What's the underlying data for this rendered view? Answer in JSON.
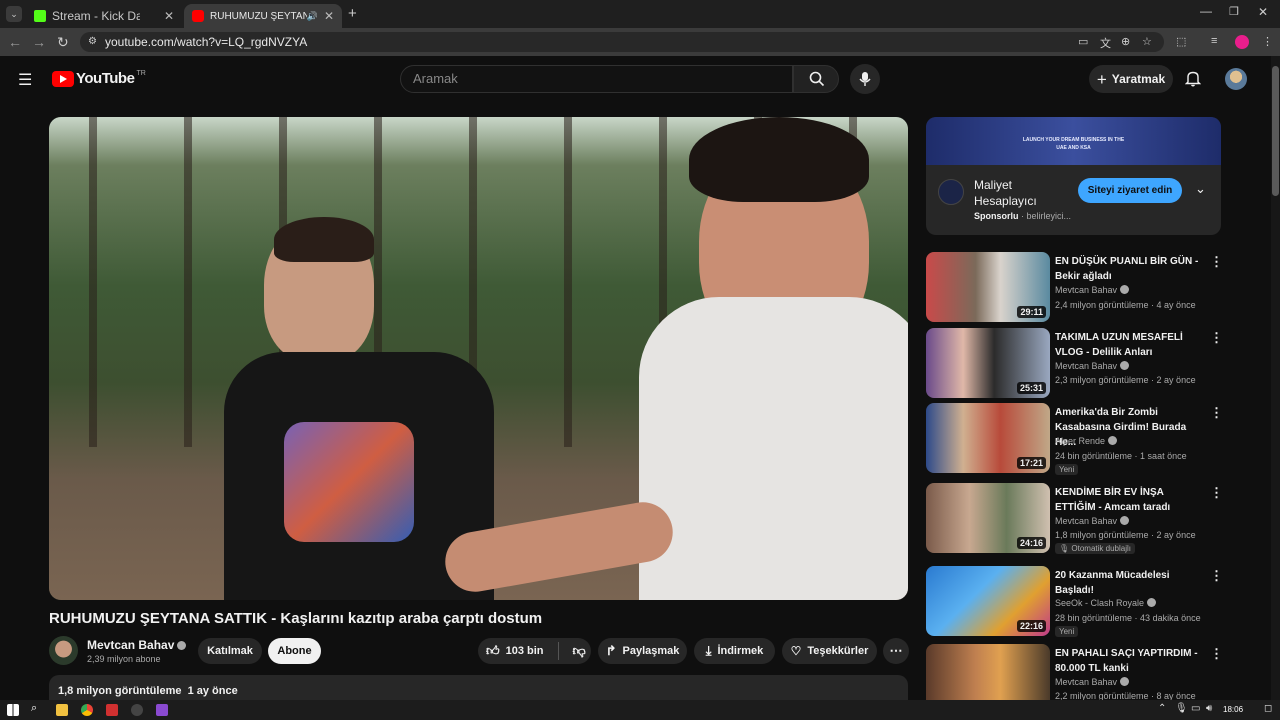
{
  "browser": {
    "tabs": [
      {
        "title": "Stream - Kick Dashboard",
        "active": false
      },
      {
        "title": "RUHUMUZU ŞEYTANA SATT",
        "active": true
      }
    ],
    "url": "youtube.com/watch?v=LQ_rgdNVZYA"
  },
  "yt": {
    "logo_text": "YouTube",
    "region": "TR",
    "search_placeholder": "Aramak",
    "create_label": "Yaratmak"
  },
  "video": {
    "title": "RUHUMUZU ŞEYTANA SATTIK - Kaşlarını kazıtıp araba çarptı dostum",
    "channel": "Mevtcan Bahav",
    "subs": "2,39 milyon abone",
    "join_label": "Katılmak",
    "subscribe_label": "Abone",
    "likes": "103 bin",
    "share_label": "Paylaşmak",
    "download_label": "İndirmek",
    "thanks_label": "Teşekkürler",
    "desc_meta": "1,8 milyon görüntüleme  1 ay önce"
  },
  "ad": {
    "banner_line1": "LAUNCH YOUR DREAM BUSINESS IN THE",
    "banner_line2": "UAE AND KSA",
    "title_line1": "Maliyet",
    "title_line2": "Hesaplayıcı",
    "sponsored": "Sponsorlu",
    "domain": "· belirleyici...",
    "cta": "Siteyi ziyaret edin"
  },
  "recommendations": [
    {
      "title": "EN DÜŞÜK PUANLI BİR GÜN - Bekir ağladı",
      "channel": "Mevtcan Bahav",
      "meta": "2,4 milyon görüntüleme · 4 ay önce",
      "duration": "29:11",
      "badge": ""
    },
    {
      "title": "TAKIMLA UZUN MESAFELİ VLOG - Delilik Anları",
      "channel": "Mevtcan Bahav",
      "meta": "2,3 milyon görüntüleme · 2 ay önce",
      "duration": "25:31",
      "badge": ""
    },
    {
      "title": "Amerika'da Bir Zombi Kasabasına Girdim! Burada He...",
      "channel": "Alper Rende",
      "meta": "24 bin görüntüleme · 1 saat önce",
      "duration": "17:21",
      "badge": "Yeni"
    },
    {
      "title": "KENDİME BİR EV İNŞA ETTİĞİM - Amcam taradı",
      "channel": "Mevtcan Bahav",
      "meta": "1,8 milyon görüntüleme · 2 ay önce",
      "duration": "24:16",
      "badge": "Otomatik dublajlı"
    },
    {
      "title": "20 Kazanma Mücadelesi Başladı!",
      "channel": "SeeOk - Clash Royale",
      "meta": "28 bin görüntüleme · 43 dakika önce",
      "duration": "22:16",
      "badge": "Yeni"
    },
    {
      "title": "EN PAHALI SAÇI YAPTIRDIM - 80.000 TL kanki",
      "channel": "Mevtcan Bahav",
      "meta": "2,2 milyon görüntüleme · 8 ay önce",
      "duration": "",
      "badge": ""
    }
  ],
  "taskbar": {
    "clock": "18:06"
  },
  "colors": {
    "bg": "#0f0f0f",
    "surface": "#272727",
    "accent_red": "#ff0000",
    "cta_blue": "#3ea6ff"
  }
}
